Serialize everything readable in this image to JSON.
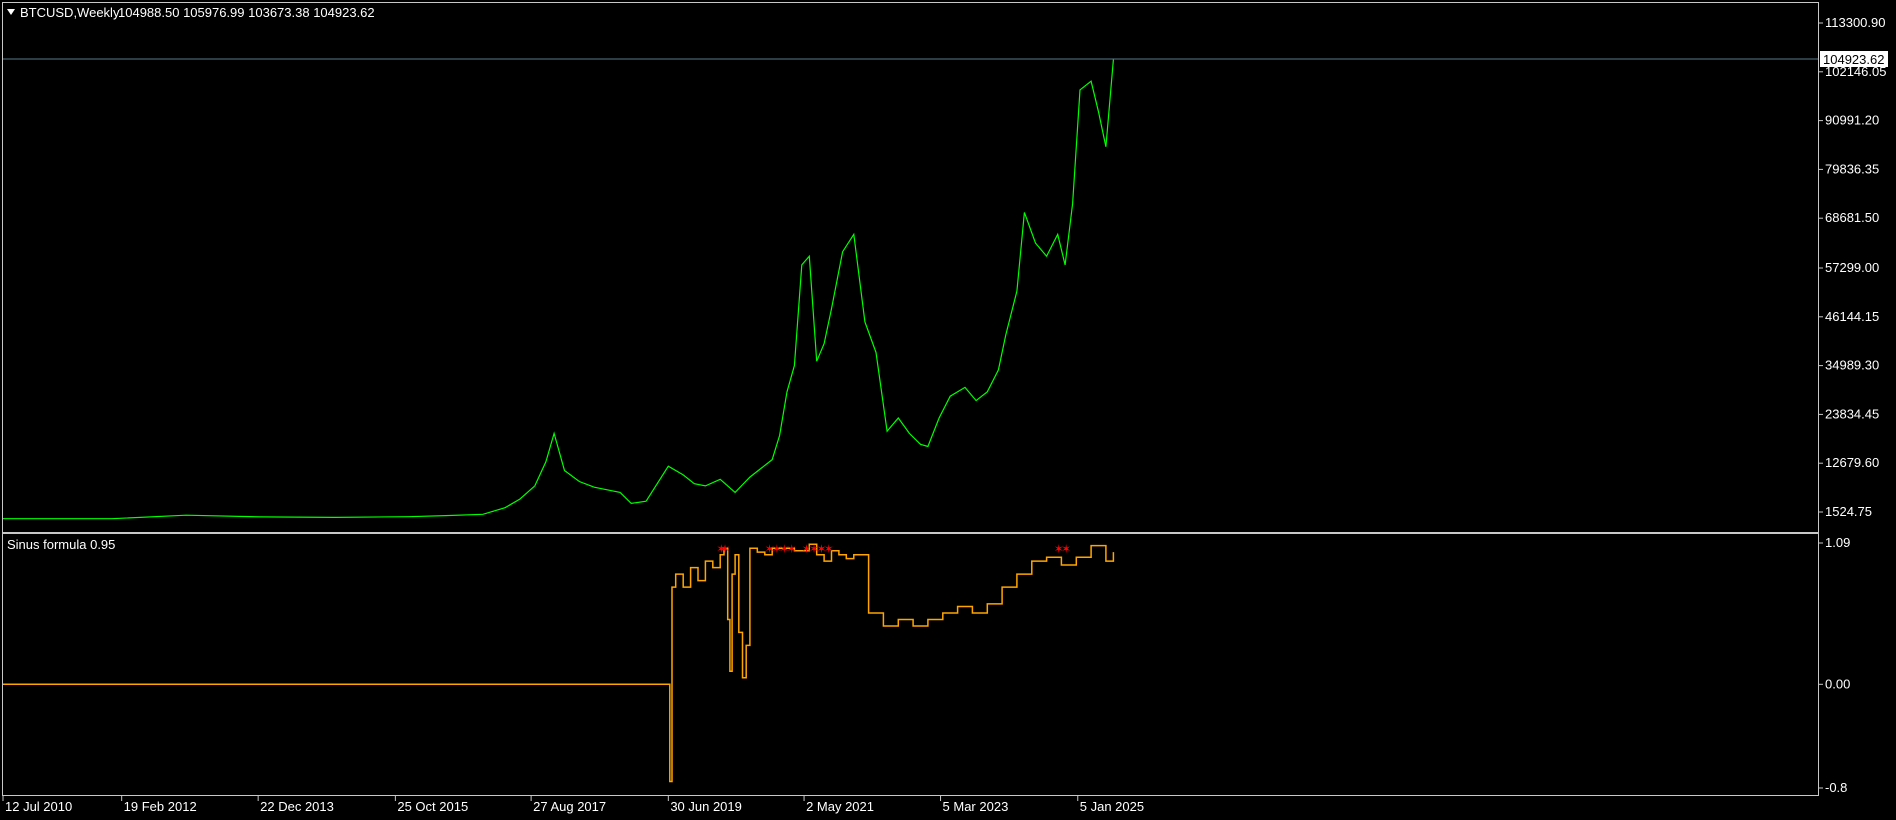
{
  "header": {
    "symbol_label": "BTCUSD,Weekly",
    "ohlc": "104988.50 105976.99 103673.38 104923.62",
    "indicator_label": "Sinus formula 0.95"
  },
  "colors": {
    "background": "#000000",
    "frame": "#c8c8c8",
    "price_line": "#00ff00",
    "indicator_line": "#ffa500",
    "signal_marker": "#ff0000",
    "bid_line": "#5a7a8c"
  },
  "icons": {
    "menu": "triangle-down-icon"
  },
  "chart_data": [
    {
      "type": "line",
      "name": "price",
      "series": [
        {
          "name": "",
          "x": [
            2010.53,
            2012.0,
            2013.0,
            2014.0,
            2015.0,
            2016.0,
            2016.5,
            2017.0,
            2017.3,
            2017.5,
            2017.7,
            2017.85,
            2017.96,
            2018.1,
            2018.3,
            2018.5,
            2018.7,
            2018.85,
            2019.0,
            2019.2,
            2019.35,
            2019.5,
            2019.7,
            2019.85,
            2020.0,
            2020.2,
            2020.4,
            2020.6,
            2020.75,
            2020.9,
            2021.0,
            2021.1,
            2021.2,
            2021.3,
            2021.4,
            2021.5,
            2021.6,
            2021.7,
            2021.85,
            2022.0,
            2022.15,
            2022.3,
            2022.45,
            2022.6,
            2022.75,
            2022.9,
            2023.0,
            2023.15,
            2023.3,
            2023.5,
            2023.65,
            2023.8,
            2023.95,
            2024.05,
            2024.2,
            2024.3,
            2024.45,
            2024.6,
            2024.75,
            2024.85,
            2024.95,
            2025.05,
            2025.2,
            2025.3,
            2025.4,
            2025.5
          ],
          "values": [
            0.1,
            3,
            800,
            400,
            300,
            450,
            700,
            1000,
            2500,
            4500,
            7500,
            13000,
            19500,
            11000,
            8500,
            7200,
            6500,
            6000,
            3500,
            4000,
            8000,
            12000,
            10000,
            8000,
            7500,
            9000,
            6000,
            9500,
            11500,
            13500,
            19000,
            29000,
            35000,
            58000,
            60000,
            36000,
            40000,
            48000,
            61000,
            65000,
            45000,
            38000,
            20000,
            23000,
            19500,
            17000,
            16500,
            23000,
            28000,
            30000,
            27000,
            29000,
            34000,
            42000,
            52000,
            70000,
            63000,
            60000,
            65000,
            58000,
            72000,
            98000,
            100000,
            93000,
            85000,
            104923.62
          ]
        }
      ],
      "ylim": [
        0,
        113300.9
      ],
      "ytick_labels": [
        "113300.90",
        "102146.05",
        "90991.20",
        "79836.35",
        "68681.50",
        "57299.00",
        "46144.15",
        "34989.30",
        "23834.45",
        "12679.60",
        "1524.75"
      ],
      "ytick_values": [
        113300.9,
        102146.05,
        90991.2,
        79836.35,
        68681.5,
        57299.0,
        46144.15,
        34989.3,
        23834.45,
        12679.6,
        1524.75
      ],
      "current_price_label": "104923.62",
      "current_price": 104923.62
    },
    {
      "type": "line",
      "name": "indicator",
      "series": [
        {
          "name": "",
          "x": [
            2010.53,
            2019.5,
            2019.52,
            2019.55,
            2019.6,
            2019.7,
            2019.8,
            2019.9,
            2020.0,
            2020.1,
            2020.2,
            2020.25,
            2020.3,
            2020.33,
            2020.36,
            2020.4,
            2020.45,
            2020.5,
            2020.55,
            2020.6,
            2020.7,
            2020.8,
            2020.9,
            2021.0,
            2021.2,
            2021.4,
            2021.5,
            2021.6,
            2021.7,
            2021.8,
            2021.9,
            2022.0,
            2022.2,
            2022.4,
            2022.6,
            2022.8,
            2023.0,
            2023.2,
            2023.4,
            2023.6,
            2023.8,
            2024.0,
            2024.2,
            2024.4,
            2024.6,
            2024.8,
            2025.0,
            2025.2,
            2025.4,
            2025.5
          ],
          "values": [
            0,
            0,
            -0.75,
            0.75,
            0.85,
            0.75,
            0.9,
            0.8,
            0.95,
            0.9,
            1.0,
            1.05,
            0.5,
            0.1,
            0.85,
            1.0,
            0.4,
            0.05,
            0.3,
            1.05,
            1.02,
            1.0,
            1.05,
            1.05,
            1.03,
            1.08,
            1.0,
            0.95,
            1.03,
            1.0,
            0.97,
            1.0,
            0.55,
            0.45,
            0.5,
            0.45,
            0.5,
            0.55,
            0.6,
            0.55,
            0.62,
            0.75,
            0.85,
            0.95,
            0.98,
            0.92,
            0.98,
            1.07,
            0.95,
            1.02
          ]
        }
      ],
      "signals_x": [
        2020.2,
        2020.25,
        2020.85,
        2020.95,
        2021.05,
        2021.15,
        2021.35,
        2021.45,
        2021.55,
        2021.65,
        2024.75,
        2024.85
      ],
      "ylim": [
        -0.8,
        1.09
      ],
      "ytick_labels": [
        "1.09",
        "0.00",
        "-0.8"
      ],
      "ytick_values": [
        1.09,
        0.0,
        -0.8
      ]
    }
  ],
  "x_axis": {
    "labels": [
      "12 Jul 2010",
      "19 Feb 2012",
      "22 Dec 2013",
      "25 Oct 2015",
      "27 Aug 2017",
      "30 Jun 2019",
      "2 May 2021",
      "5 Mar 2023",
      "5 Jan 2025"
    ],
    "label_values": [
      2010.53,
      2012.13,
      2013.97,
      2015.82,
      2017.65,
      2019.5,
      2021.33,
      2023.17,
      2025.02
    ],
    "range": [
      2010.53,
      2035.0
    ]
  }
}
